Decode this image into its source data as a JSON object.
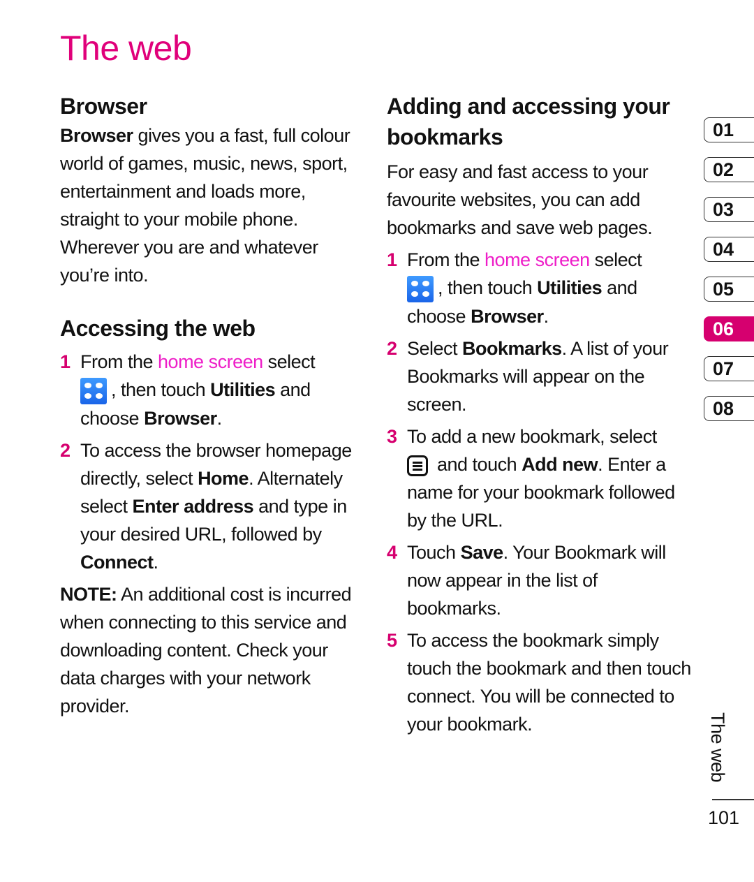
{
  "page": {
    "title": "The web",
    "accent_color": "#d6006f",
    "highlight_color": "#ee1ec8",
    "page_number": "101",
    "side_label": "The web"
  },
  "left": {
    "browser_heading": "Browser",
    "browser_intro_bold": "Browser",
    "browser_intro_rest": " gives you a fast, full colour world of games, music, news, sport, entertainment and loads more, straight to your mobile phone. Wherever you are and whatever you’re into.",
    "accessing_heading": "Accessing the web",
    "steps": [
      {
        "num": "1",
        "t1": "From the ",
        "link": "home screen",
        "t2": " select",
        "icon": "utilities-grid-icon",
        "t3": ", then touch ",
        "b1": "Utilities",
        "t4": " and choose ",
        "b2": "Browser",
        "t5": "."
      },
      {
        "num": "2",
        "t1": "To access the browser homepage directly, select ",
        "b1": "Home",
        "t2": ". Alternately select ",
        "b2": "Enter address",
        "t3": " and type in your desired URL, followed by ",
        "b3": "Connect",
        "t4": "."
      }
    ],
    "note_bold": "NOTE:",
    "note_rest": " An additional cost is incurred when connecting to this service and downloading content. Check your data charges with your network provider."
  },
  "right": {
    "heading": "Adding and accessing your bookmarks",
    "intro": "For easy and fast access to your favourite websites, you can add bookmarks and save web pages.",
    "steps": [
      {
        "num": "1",
        "t1": "From the ",
        "link": "home screen",
        "t2": " select",
        "icon": "utilities-grid-icon",
        "t3": ", then touch ",
        "b1": "Utilities",
        "t4": " and choose ",
        "b2": "Browser",
        "t5": "."
      },
      {
        "num": "2",
        "t1": "Select ",
        "b1": "Bookmarks",
        "t2": ". A list of your Bookmarks will appear on the screen."
      },
      {
        "num": "3",
        "t1": "To add a new bookmark, select ",
        "icon": "menu-icon",
        "t2": " and touch ",
        "b1": "Add new",
        "t3": ". Enter a name for your bookmark followed by the URL."
      },
      {
        "num": "4",
        "t1": "Touch ",
        "b1": "Save",
        "t2": ". Your Bookmark will now appear in the list of bookmarks."
      },
      {
        "num": "5",
        "t1": "To access the bookmark simply touch the bookmark and then touch connect. You will be connected to your bookmark."
      }
    ]
  },
  "chapter_tabs": [
    {
      "label": "01",
      "active": false
    },
    {
      "label": "02",
      "active": false
    },
    {
      "label": "03",
      "active": false
    },
    {
      "label": "04",
      "active": false
    },
    {
      "label": "05",
      "active": false
    },
    {
      "label": "06",
      "active": true
    },
    {
      "label": "07",
      "active": false
    },
    {
      "label": "08",
      "active": false
    }
  ]
}
